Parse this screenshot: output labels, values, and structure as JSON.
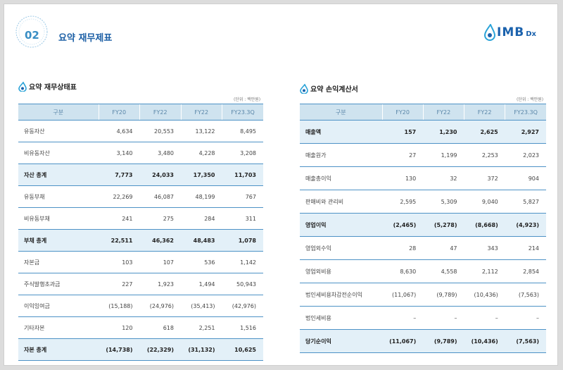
{
  "header": {
    "number": "02",
    "title": "요약 재무제표"
  },
  "logo": {
    "word": "IMB",
    "sub": "Dx"
  },
  "balance_sheet": {
    "title": "요약 재무상태표",
    "unit": "(단위 : 백만원)",
    "columns": [
      "구분",
      "FY20",
      "FY22",
      "FY22",
      "FY23.3Q"
    ],
    "rows": [
      {
        "label": "유동자산",
        "values": [
          "4,634",
          "20,553",
          "13,122",
          "8,495"
        ]
      },
      {
        "label": "비유동자산",
        "values": [
          "3,140",
          "3,480",
          "4,228",
          "3,208"
        ]
      },
      {
        "label": "자산 총계",
        "values": [
          "7,773",
          "24,033",
          "17,350",
          "11,703"
        ]
      },
      {
        "label": "유동부채",
        "values": [
          "22,269",
          "46,087",
          "48,199",
          "767"
        ]
      },
      {
        "label": "비유동부채",
        "values": [
          "241",
          "275",
          "284",
          "311"
        ]
      },
      {
        "label": "부채 총계",
        "values": [
          "22,511",
          "46,362",
          "48,483",
          "1,078"
        ]
      },
      {
        "label": "자본금",
        "values": [
          "103",
          "107",
          "536",
          "1,142"
        ]
      },
      {
        "label": "주식발행초과금",
        "values": [
          "227",
          "1,923",
          "1,494",
          "50,943"
        ]
      },
      {
        "label": "이익잉여금",
        "values": [
          "(15,188)",
          "(24,976)",
          "(35,413)",
          "(42,976)"
        ]
      },
      {
        "label": "기타자본",
        "values": [
          "120",
          "618",
          "2,251",
          "1,516"
        ]
      },
      {
        "label": "자본 총계",
        "values": [
          "(14,738)",
          "(22,329)",
          "(31,132)",
          "10,625"
        ]
      }
    ]
  },
  "income_statement": {
    "title": "요약 손익계산서",
    "unit": "(단위 : 백만원)",
    "columns": [
      "구분",
      "FY20",
      "FY22",
      "FY22",
      "FY23.3Q"
    ],
    "rows": [
      {
        "label": "매출액",
        "values": [
          "157",
          "1,230",
          "2,625",
          "2,927"
        ]
      },
      {
        "label": "매출원가",
        "values": [
          "27",
          "1,199",
          "2,253",
          "2,023"
        ]
      },
      {
        "label": "매출총이익",
        "values": [
          "130",
          "32",
          "372",
          "904"
        ]
      },
      {
        "label": "판매비와 관리비",
        "values": [
          "2,595",
          "5,309",
          "9,040",
          "5,827"
        ]
      },
      {
        "label": "영업이익",
        "values": [
          "(2,465)",
          "(5,278)",
          "(8,668)",
          "(4,923)"
        ]
      },
      {
        "label": "영업외수익",
        "values": [
          "28",
          "47",
          "343",
          "214"
        ]
      },
      {
        "label": "영업외비용",
        "values": [
          "8,630",
          "4,558",
          "2,112",
          "2,854"
        ]
      },
      {
        "label": "법인세비용차감전순이익",
        "values": [
          "(11,067)",
          "(9,789)",
          "(10,436)",
          "(7,563)"
        ]
      },
      {
        "label": "법인세비용",
        "values": [
          "–",
          "–",
          "–",
          "–"
        ]
      },
      {
        "label": "당기순이익",
        "values": [
          "(11,067)",
          "(9,789)",
          "(10,436)",
          "(7,563)"
        ]
      }
    ]
  },
  "colors": {
    "accent": "#1c5fa5",
    "header_fill": "#cfe3ef",
    "total_fill": "#e3f0f8",
    "rule": "#4d92c6"
  }
}
